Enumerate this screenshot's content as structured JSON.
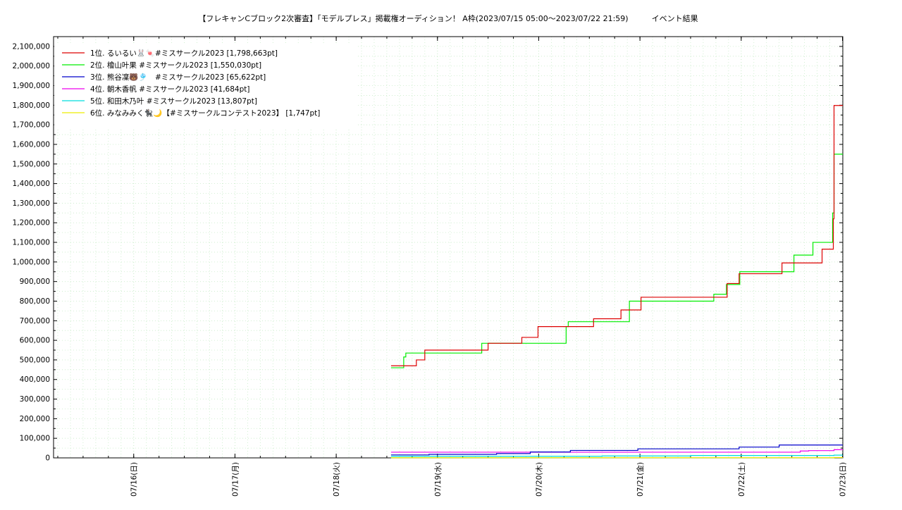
{
  "chart_data": {
    "type": "line",
    "title": "【フレキャンCブロック2次審査】「モデルプレス」掲載権オーディション！ A枠(2023/07/15 05:00〜2023/07/22 21:59)　　　イベント結果",
    "xlabel": "",
    "ylabel": "",
    "x_domain": [
      "2023-07-15T05:00",
      "2023-07-23T00:05"
    ],
    "x_ticks": [
      {
        "label": "07/16(日)",
        "x": "2023-07-16T00:00"
      },
      {
        "label": "07/17(月)",
        "x": "2023-07-17T00:00"
      },
      {
        "label": "07/18(火)",
        "x": "2023-07-18T00:00"
      },
      {
        "label": "07/19(水)",
        "x": "2023-07-19T00:00"
      },
      {
        "label": "07/20(木)",
        "x": "2023-07-20T00:00"
      },
      {
        "label": "07/21(金)",
        "x": "2023-07-21T00:00"
      },
      {
        "label": "07/22(土)",
        "x": "2023-07-22T00:00"
      },
      {
        "label": "07/23(日)",
        "x": "2023-07-23T00:00"
      }
    ],
    "ylim": [
      0,
      2150000
    ],
    "y_ticks": [
      {
        "value": 0,
        "label": "0"
      },
      {
        "value": 100000,
        "label": "100,000"
      },
      {
        "value": 200000,
        "label": "200,000"
      },
      {
        "value": 300000,
        "label": "300,000"
      },
      {
        "value": 400000,
        "label": "400,000"
      },
      {
        "value": 500000,
        "label": "500,000"
      },
      {
        "value": 600000,
        "label": "600,000"
      },
      {
        "value": 700000,
        "label": "700,000"
      },
      {
        "value": 800000,
        "label": "800,000"
      },
      {
        "value": 900000,
        "label": "900,000"
      },
      {
        "value": 1000000,
        "label": "1,000,000"
      },
      {
        "value": 1100000,
        "label": "1,100,000"
      },
      {
        "value": 1200000,
        "label": "1,200,000"
      },
      {
        "value": 1300000,
        "label": "1,300,000"
      },
      {
        "value": 1400000,
        "label": "1,400,000"
      },
      {
        "value": 1500000,
        "label": "1,500,000"
      },
      {
        "value": 1600000,
        "label": "1,600,000"
      },
      {
        "value": 1700000,
        "label": "1,700,000"
      },
      {
        "value": 1800000,
        "label": "1,800,000"
      },
      {
        "value": 1900000,
        "label": "1,900,000"
      },
      {
        "value": 2000000,
        "label": "2,000,000"
      },
      {
        "value": 2100000,
        "label": "2,100,000"
      }
    ],
    "grid": true,
    "legend_position": "top-left",
    "series": [
      {
        "name": "1位. るいるい🐰🍬#ミスサークル2023 [1,798,663pt]",
        "color": "#dd0000",
        "step": true,
        "points": [
          [
            "2023-07-18T13:00",
            470000
          ],
          [
            "2023-07-18T18:30",
            470000
          ],
          [
            "2023-07-18T19:00",
            500000
          ],
          [
            "2023-07-18T20:30",
            500000
          ],
          [
            "2023-07-18T21:00",
            550000
          ],
          [
            "2023-07-19T11:00",
            550000
          ],
          [
            "2023-07-19T12:00",
            585000
          ],
          [
            "2023-07-19T19:30",
            585000
          ],
          [
            "2023-07-19T20:00",
            615000
          ],
          [
            "2023-07-19T22:30",
            615000
          ],
          [
            "2023-07-19T23:50",
            670000
          ],
          [
            "2023-07-20T12:30",
            670000
          ],
          [
            "2023-07-20T13:00",
            710000
          ],
          [
            "2023-07-20T19:00",
            710000
          ],
          [
            "2023-07-20T19:30",
            755000
          ],
          [
            "2023-07-20T23:30",
            755000
          ],
          [
            "2023-07-21T00:15",
            820000
          ],
          [
            "2023-07-21T20:00",
            820000
          ],
          [
            "2023-07-21T20:40",
            890000
          ],
          [
            "2023-07-21T23:00",
            890000
          ],
          [
            "2023-07-21T23:30",
            940000
          ],
          [
            "2023-07-22T09:15",
            940000
          ],
          [
            "2023-07-22T09:40",
            995000
          ],
          [
            "2023-07-22T18:50",
            995000
          ],
          [
            "2023-07-22T19:10",
            1065000
          ],
          [
            "2023-07-22T21:00",
            1065000
          ],
          [
            "2023-07-22T21:50",
            1220000
          ],
          [
            "2023-07-22T22:00",
            1798663
          ],
          [
            "2023-07-23T00:05",
            1798663
          ]
        ]
      },
      {
        "name": "2位. 檜山叶果 #ミスサークル2023 [1,550,030pt]",
        "color": "#00ee00",
        "step": true,
        "points": [
          [
            "2023-07-18T13:00",
            460000
          ],
          [
            "2023-07-18T15:30",
            460000
          ],
          [
            "2023-07-18T16:00",
            515000
          ],
          [
            "2023-07-18T16:30",
            535000
          ],
          [
            "2023-07-19T10:00",
            535000
          ],
          [
            "2023-07-19T10:30",
            585000
          ],
          [
            "2023-07-19T19:30",
            585000
          ],
          [
            "2023-07-19T22:00",
            585000
          ],
          [
            "2023-07-20T06:00",
            585000
          ],
          [
            "2023-07-20T06:30",
            670000
          ],
          [
            "2023-07-20T07:00",
            695000
          ],
          [
            "2023-07-20T21:00",
            695000
          ],
          [
            "2023-07-20T21:30",
            800000
          ],
          [
            "2023-07-21T17:00",
            800000
          ],
          [
            "2023-07-21T17:30",
            835000
          ],
          [
            "2023-07-21T20:00",
            835000
          ],
          [
            "2023-07-21T20:30",
            885000
          ],
          [
            "2023-07-21T23:00",
            885000
          ],
          [
            "2023-07-21T23:40",
            950000
          ],
          [
            "2023-07-22T12:00",
            950000
          ],
          [
            "2023-07-22T12:30",
            1035000
          ],
          [
            "2023-07-22T16:30",
            1035000
          ],
          [
            "2023-07-22T17:00",
            1100000
          ],
          [
            "2023-07-22T20:30",
            1100000
          ],
          [
            "2023-07-22T21:40",
            1250000
          ],
          [
            "2023-07-22T22:00",
            1550030
          ],
          [
            "2023-07-23T00:05",
            1550030
          ]
        ]
      },
      {
        "name": "3位. 熊谷凜🐻🎐　#ミスサークル2023 [65,622pt]",
        "color": "#0000cc",
        "step": true,
        "points": [
          [
            "2023-07-18T13:00",
            15000
          ],
          [
            "2023-07-18T22:00",
            18000
          ],
          [
            "2023-07-19T14:00",
            22000
          ],
          [
            "2023-07-19T22:00",
            30000
          ],
          [
            "2023-07-20T07:30",
            38000
          ],
          [
            "2023-07-20T23:30",
            46000
          ],
          [
            "2023-07-21T23:30",
            55000
          ],
          [
            "2023-07-22T09:00",
            65622
          ],
          [
            "2023-07-23T00:05",
            65622
          ]
        ]
      },
      {
        "name": "4位. 朝木香帆 #ミスサークル2023 [41,684pt]",
        "color": "#ee00ee",
        "step": true,
        "points": [
          [
            "2023-07-18T13:00",
            29000
          ],
          [
            "2023-07-19T14:00",
            29000
          ],
          [
            "2023-07-20T17:00",
            29000
          ],
          [
            "2023-07-22T14:00",
            35000
          ],
          [
            "2023-07-22T16:00",
            37000
          ],
          [
            "2023-07-22T22:00",
            41684
          ],
          [
            "2023-07-23T00:05",
            41684
          ]
        ]
      },
      {
        "name": "5位. 和田木乃叶 #ミスサークル2023 [13,807pt]",
        "color": "#00dddd",
        "step": true,
        "points": [
          [
            "2023-07-18T13:00",
            8000
          ],
          [
            "2023-07-20T15:00",
            10000
          ],
          [
            "2023-07-21T12:00",
            12000
          ],
          [
            "2023-07-22T22:00",
            13807
          ],
          [
            "2023-07-23T00:05",
            13807
          ]
        ]
      },
      {
        "name": "6位. みなみみく🐈‍⬛🌙【#ミスサークルコンテスト2023】 [1,747pt]",
        "color": "#eeee00",
        "step": true,
        "points": [
          [
            "2023-07-18T13:00",
            1000
          ],
          [
            "2023-07-22T22:00",
            1747
          ],
          [
            "2023-07-23T00:05",
            1747
          ]
        ]
      }
    ]
  }
}
